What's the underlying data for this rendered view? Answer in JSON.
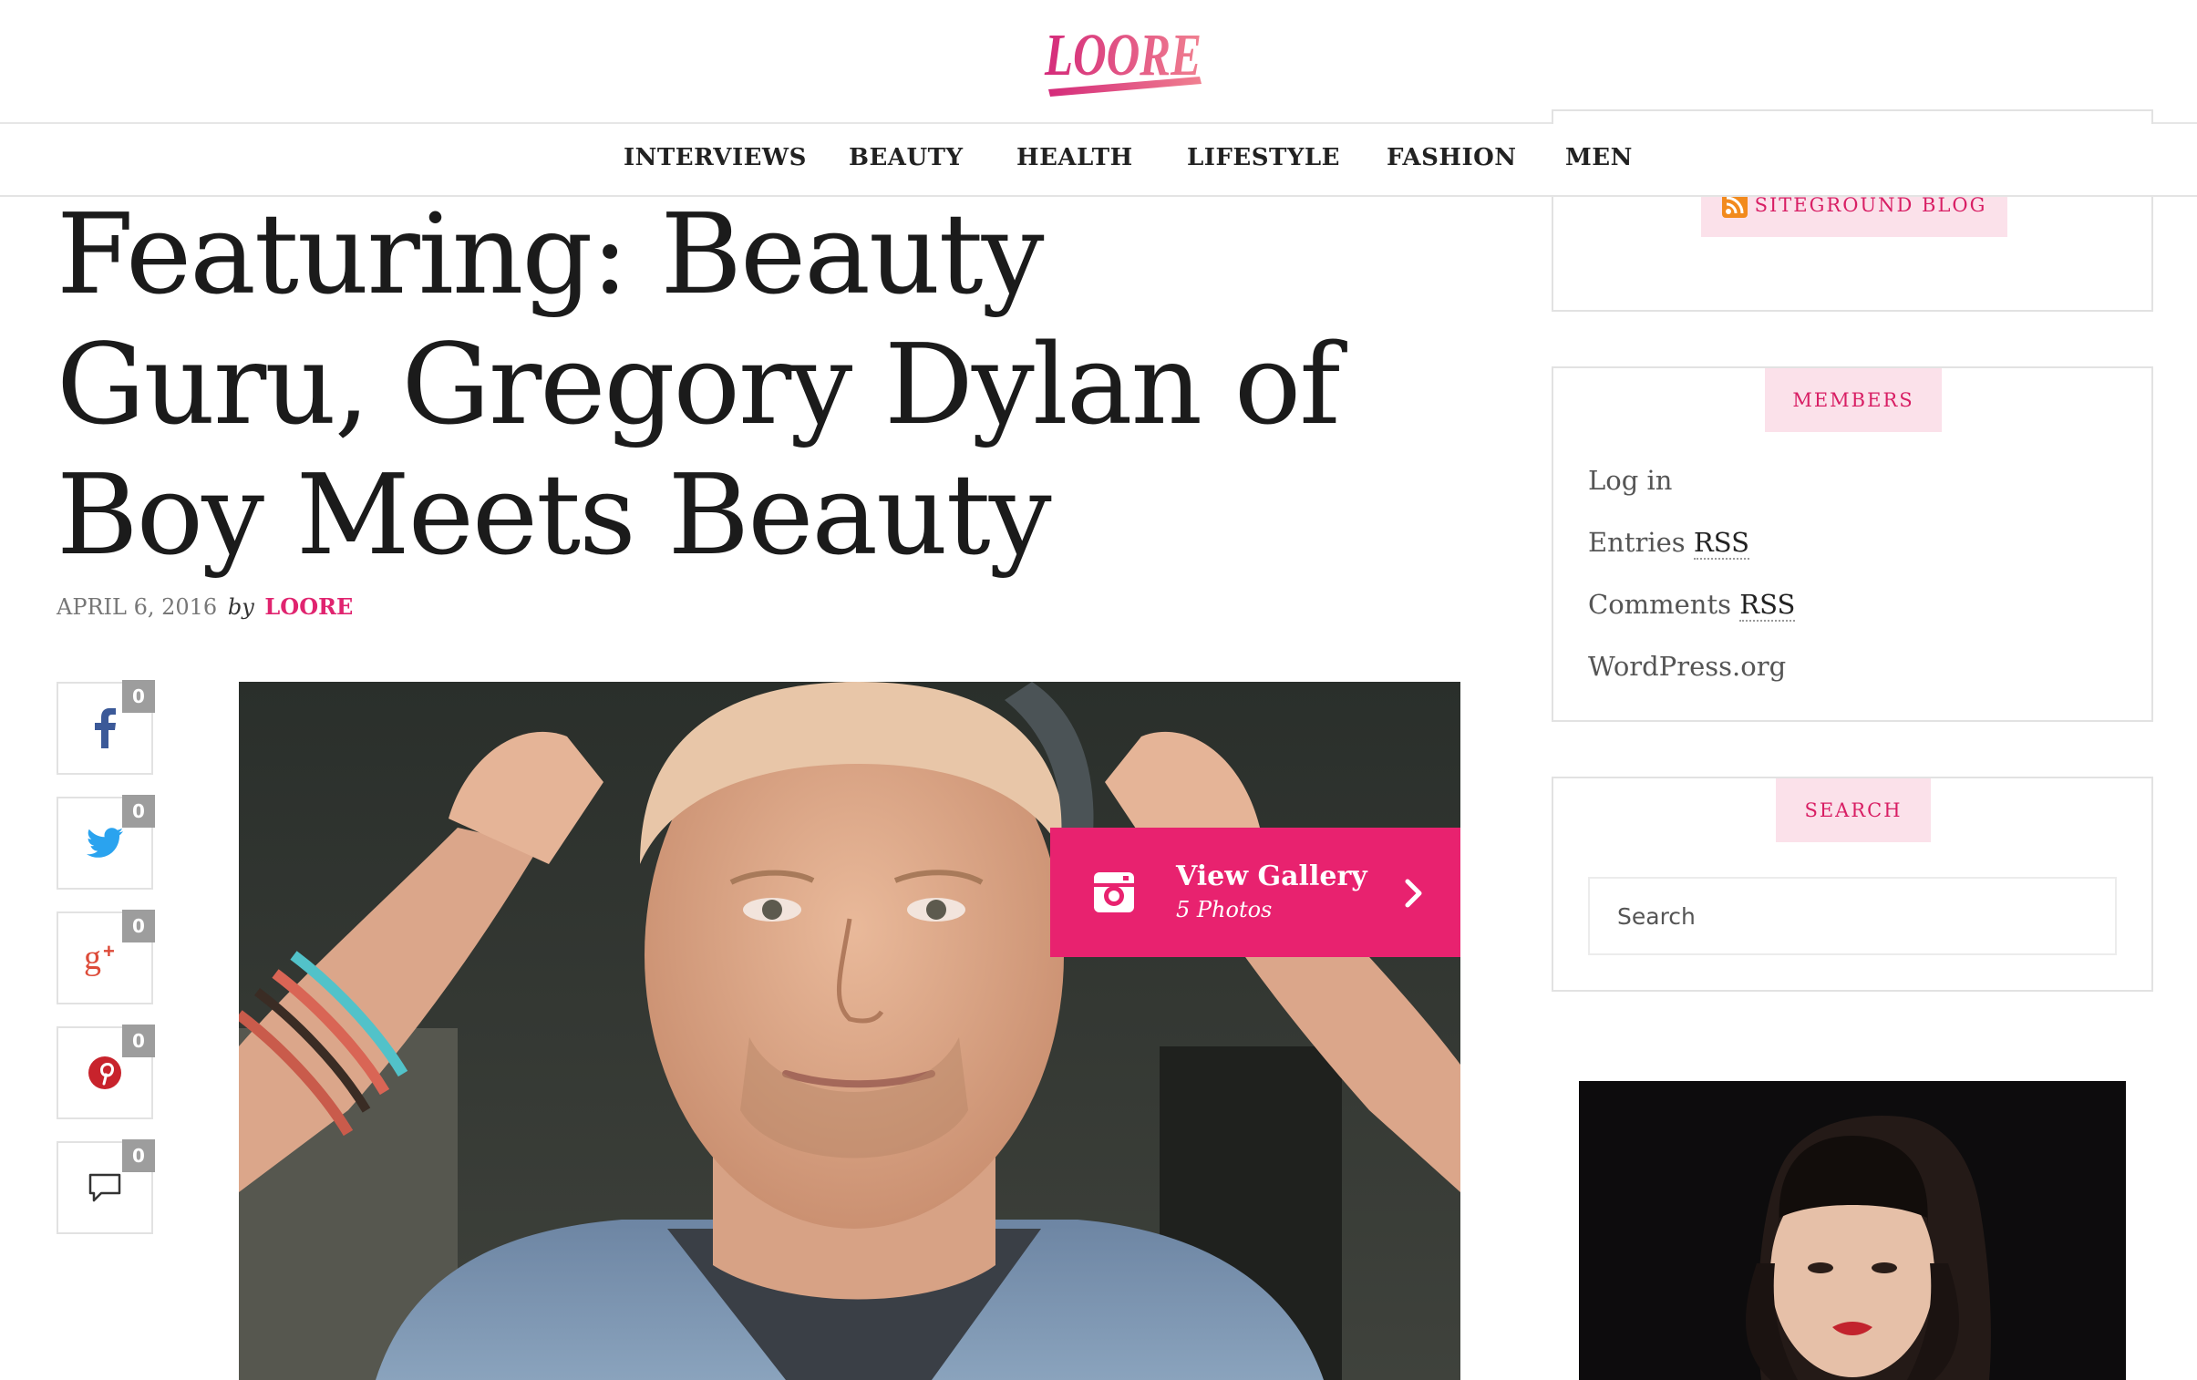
{
  "site": {
    "logo_text": "LOORE"
  },
  "nav": {
    "items": [
      "INTERVIEWS",
      "BEAUTY",
      "HEALTH",
      "LIFESTYLE",
      "FASHION",
      "MEN"
    ]
  },
  "article": {
    "title": "Featuring: Beauty Guru, Gregory Dylan of Boy Meets Beauty",
    "date": "APRIL 6, 2016",
    "by": "by",
    "author": "LOORE"
  },
  "share": [
    {
      "icon": "facebook-icon",
      "count": "0"
    },
    {
      "icon": "twitter-icon",
      "count": "0"
    },
    {
      "icon": "google-plus-icon",
      "count": "0"
    },
    {
      "icon": "pinterest-icon",
      "count": "0"
    },
    {
      "icon": "comment-icon",
      "count": "0"
    }
  ],
  "gallery": {
    "title": "View Gallery",
    "subtitle": "5 Photos"
  },
  "sidebar": {
    "rss_label": "SITEGROUND BLOG",
    "members": {
      "title": "MEMBERS",
      "links": [
        {
          "text": "Log in",
          "abbr": ""
        },
        {
          "text": "Entries ",
          "abbr": "RSS"
        },
        {
          "text": "Comments ",
          "abbr": "RSS"
        },
        {
          "text": "WordPress.org",
          "abbr": ""
        }
      ]
    },
    "search": {
      "title": "SEARCH",
      "placeholder": "Search"
    }
  },
  "colors": {
    "accent": "#e8226f",
    "widget_title_bg": "#fbe1ea",
    "count_badge": "#9d9d9d"
  }
}
